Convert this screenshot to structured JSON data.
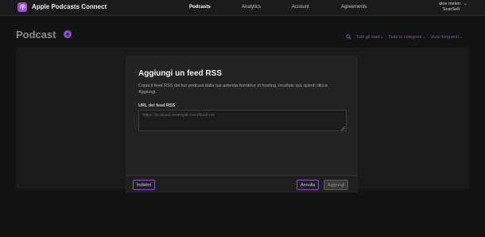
{
  "app": {
    "brand_name": "Apple Podcasts Connect",
    "brand_icon": "podcast-icon",
    "accent_color": "#a44bd8"
  },
  "nav": {
    "items": [
      {
        "label": "Podcasts",
        "active": true
      },
      {
        "label": "Analytics",
        "active": false
      },
      {
        "label": "Account",
        "active": false
      },
      {
        "label": "Agreements",
        "active": false
      }
    ]
  },
  "user": {
    "name": "aloe melen",
    "org": "SoarSelt",
    "icon": "chevron-down-icon"
  },
  "page": {
    "title": "Podcast",
    "add_icon": "plus-icon"
  },
  "filters": {
    "search_icon": "search-icon",
    "items": [
      "Tutti gli stati",
      "Tutte le categorie",
      "Visto frequenti"
    ]
  },
  "modal": {
    "title": "Aggiungi un feed RSS",
    "description": "Copia il feed RSS del tuo podcast dalla tua azienda fornitrice di hosting, incollalo qui, quindi clicca Aggiungi.",
    "field_label": "URL del feed RSS",
    "url_value": "",
    "url_placeholder": "https://podcast.example.com/feed.rss",
    "back_label": "Indietro",
    "cancel_label": "Annulla",
    "add_label": "Aggiungi"
  }
}
